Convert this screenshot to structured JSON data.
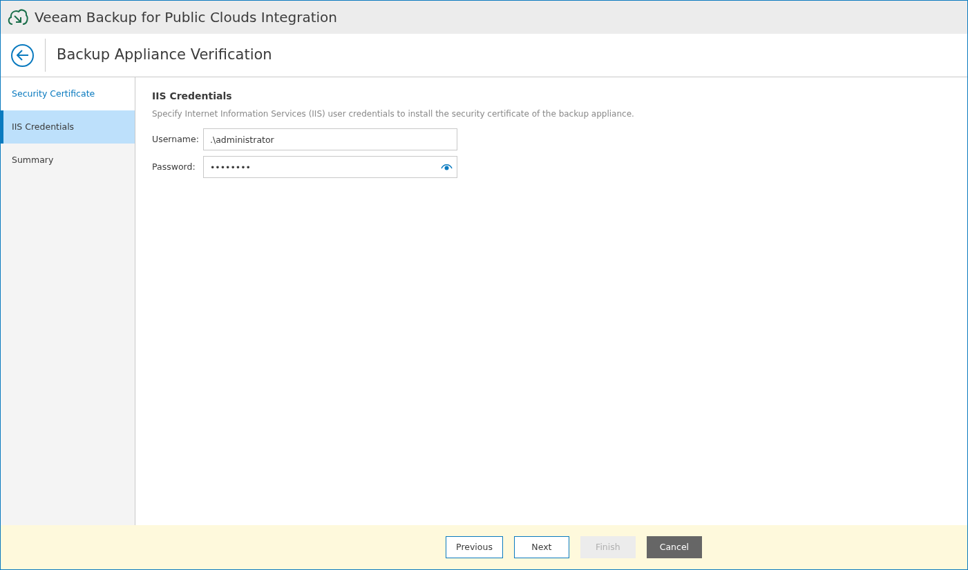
{
  "window": {
    "title": "Veeam Backup for Public Clouds Integration"
  },
  "page": {
    "title": "Backup Appliance Verification"
  },
  "steps": [
    {
      "label": "Security Certificate",
      "selected": false,
      "completed": true
    },
    {
      "label": "IIS Credentials",
      "selected": true,
      "completed": false
    },
    {
      "label": "Summary",
      "selected": false,
      "completed": false
    }
  ],
  "content": {
    "heading": "IIS Credentials",
    "description": "Specify Internet Information Services (IIS) user credentials to install the security certificate of the backup appliance.",
    "fields": [
      {
        "label": "Username:",
        "value": ".\\administrator",
        "kind": "text"
      },
      {
        "label": "Password:",
        "value": "••••••••",
        "kind": "password"
      }
    ]
  },
  "buttons": [
    {
      "label": "Previous",
      "kind": "outline",
      "disabled": false
    },
    {
      "label": "Next",
      "kind": "outline",
      "disabled": false
    },
    {
      "label": "Finish",
      "kind": "outline",
      "disabled": true
    },
    {
      "label": "Cancel",
      "kind": "dark",
      "disabled": false
    }
  ]
}
